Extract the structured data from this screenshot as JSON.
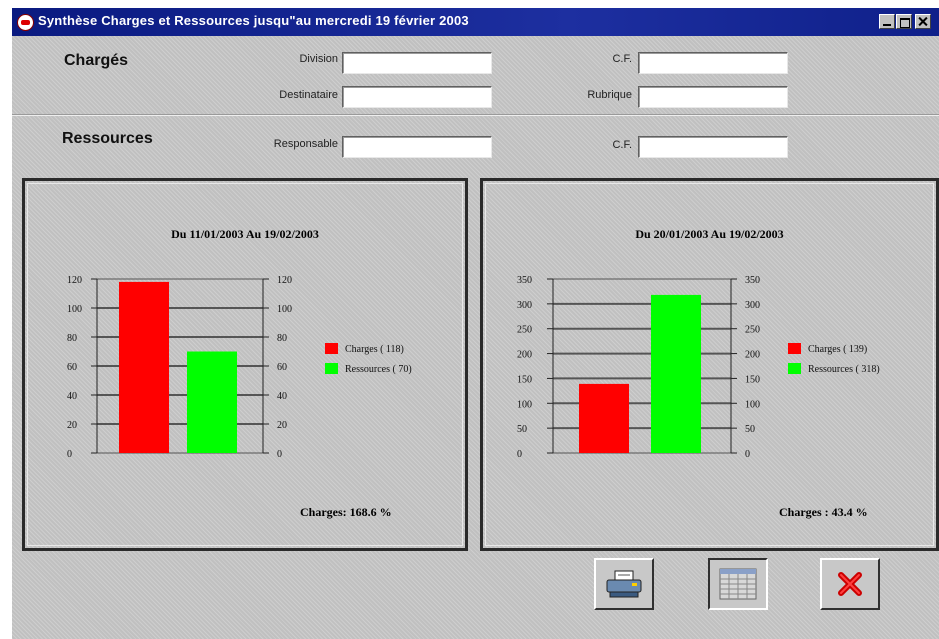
{
  "window": {
    "title": "Synthèse Charges et Ressources jusqu\"au mercredi 19 février 2003"
  },
  "charges_section": {
    "heading": "Chargés",
    "division_label": "Division",
    "division_value": "",
    "cf_label": "C.F.",
    "cf_value": "",
    "destinataire_label": "Destinataire",
    "destinataire_value": "",
    "rubrique_label": "Rubrique",
    "rubrique_value": ""
  },
  "ressources_section": {
    "heading": "Ressources",
    "responsable_label": "Responsable",
    "responsable_value": "",
    "cf_label": "C.F.",
    "cf_value": ""
  },
  "chart_data": [
    {
      "type": "bar",
      "title": "Du 11/01/2003 Au 19/02/2003",
      "categories": [
        "Charges",
        "Ressources"
      ],
      "series": [
        {
          "name": "Charges ( 118)",
          "values": [
            118
          ],
          "color": "#ff0000"
        },
        {
          "name": "Ressources ( 70)",
          "values": [
            70
          ],
          "color": "#00ff00"
        }
      ],
      "legend_labels": [
        "Charges ( 118)",
        "Ressources ( 70)"
      ],
      "ylim": [
        0,
        120
      ],
      "yticks": [
        "0",
        "20",
        "40",
        "60",
        "80",
        "100",
        "120"
      ],
      "secondary_yticks": [
        "0",
        "20",
        "40",
        "60",
        "80",
        "100",
        "120"
      ],
      "grid": true,
      "legend_position": "right",
      "summary": "Charges: 168.6 %"
    },
    {
      "type": "bar",
      "title": "Du 20/01/2003 Au 19/02/2003",
      "categories": [
        "Charges",
        "Ressources"
      ],
      "series": [
        {
          "name": "Charges ( 139)",
          "values": [
            139
          ],
          "color": "#ff0000"
        },
        {
          "name": "Ressources ( 318)",
          "values": [
            318
          ],
          "color": "#00ff00"
        }
      ],
      "legend_labels": [
        "Charges ( 139)",
        "Ressources ( 318)"
      ],
      "ylim": [
        0,
        350
      ],
      "yticks": [
        "0",
        "50",
        "100",
        "150",
        "200",
        "250",
        "300",
        "350"
      ],
      "secondary_yticks": [
        "0",
        "50",
        "100",
        "150",
        "200",
        "250",
        "300",
        "350"
      ],
      "grid": true,
      "legend_position": "right",
      "summary": "Charges : 43.4 %"
    }
  ],
  "toolbar": {
    "print_icon": "printer-icon",
    "table_icon": "spreadsheet-icon",
    "close_icon": "red-x-icon"
  }
}
